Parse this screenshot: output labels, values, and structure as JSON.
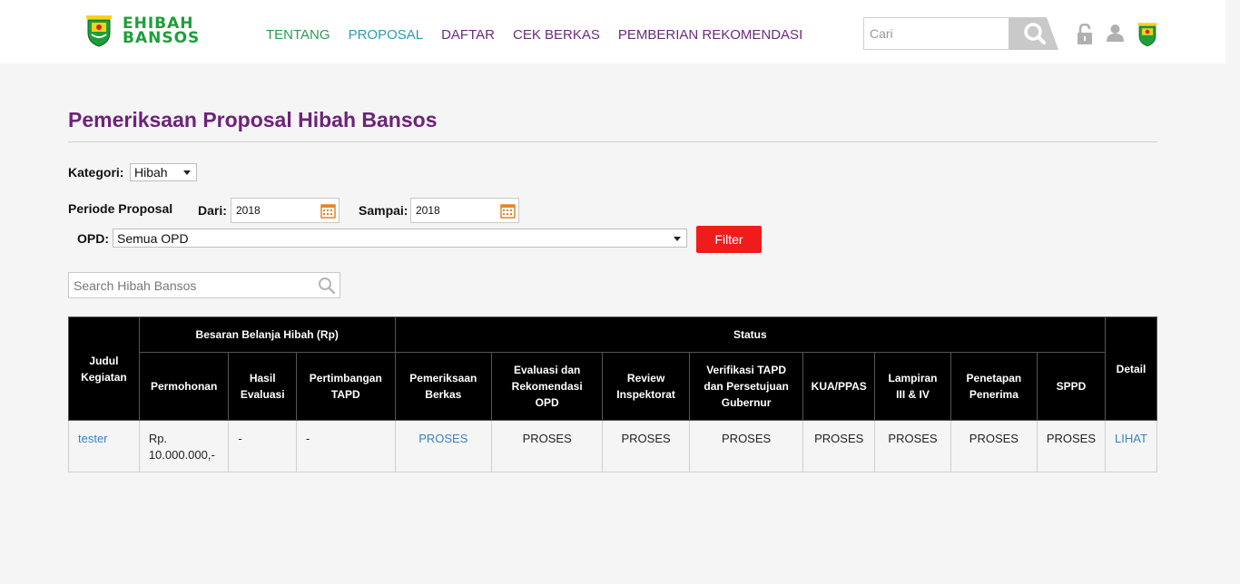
{
  "header": {
    "logo_line1": "EHIBAH",
    "logo_line2": "BANSOS",
    "nav": [
      "TENTANG",
      "PROPOSAL",
      "DAFTAR",
      "CEK BERKAS",
      "PEMBERIAN REKOMENDASI"
    ],
    "search_placeholder": "Cari"
  },
  "page": {
    "title": "Pemeriksaan Proposal Hibah Bansos"
  },
  "filters": {
    "kategori_label": "Kategori:",
    "kategori_value": "Hibah",
    "periode_label": "Periode Proposal",
    "dari_label": "Dari:",
    "dari_value": "2018",
    "sampai_label": "Sampai:",
    "sampai_value": "2018",
    "opd_label": "OPD:",
    "opd_value": "Semua OPD",
    "filter_button": "Filter",
    "table_search_placeholder": "Search Hibah Bansos"
  },
  "table": {
    "h_judul": "Judul Kegiatan",
    "h_besaran": "Besaran Belanja Hibah (Rp)",
    "h_status": "Status",
    "h_detail": "Detail",
    "h_permohonan": "Permohonan",
    "h_hasil": "Hasil Evaluasi",
    "h_pertimbangan": "Pertimbangan TAPD",
    "h_pemeriksaan": "Pemeriksaan Berkas",
    "h_evaluasi": "Evaluasi dan Rekomendasi OPD",
    "h_review": "Review Inspektorat",
    "h_verifikasi": "Verifikasi TAPD dan Persetujuan Gubernur",
    "h_kua": "KUA/PPAS",
    "h_lampiran": "Lampiran III & IV",
    "h_penetapan": "Penetapan Penerima",
    "h_sppd": "SPPD",
    "rows": [
      {
        "judul": "tester",
        "permohonan": "Rp. 10.000.000,-",
        "hasil": "-",
        "pertimbangan": "-",
        "pemeriksaan": "PROSES",
        "evaluasi": "PROSES",
        "review": "PROSES",
        "verifikasi": "PROSES",
        "kua": "PROSES",
        "lampiran": "PROSES",
        "penetapan": "PROSES",
        "sppd": "PROSES",
        "detail": "LIHAT"
      }
    ]
  },
  "colors": {
    "brand_green": "#1e9e3b",
    "title_purple": "#6d2379",
    "link_blue": "#3a83c4",
    "filter_red": "#f01c1c"
  }
}
